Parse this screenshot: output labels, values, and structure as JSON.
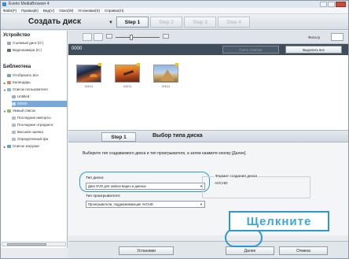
{
  "window": {
    "title": "Everio MediaBrowser 4",
    "controls": [
      "minimize",
      "maximize",
      "close"
    ]
  },
  "menu": [
    "Файл(F)",
    "Правка(E)",
    "Вид(V)",
    "Окно(W)",
    "Установки(S)",
    "Справка(H)"
  ],
  "header": {
    "mode": "Создать диск",
    "mode_arrow": "▼",
    "steps": [
      "Step 1",
      "Step 2",
      "Step 3",
      "Step 4"
    ],
    "active_step": 0
  },
  "sidebar": {
    "device_header": "Устройство",
    "devices": [
      "Съемный диск (G:)",
      "Видеокамера (H:)"
    ],
    "library_header": "Библиотека",
    "library": [
      {
        "label": "Отобразить все",
        "level": 1
      },
      {
        "label": "Календарь",
        "level": 1,
        "caret": "►"
      },
      {
        "label": "Список пользователя",
        "level": 1,
        "caret": "▼"
      },
      {
        "label": "Untitled",
        "level": 2
      },
      {
        "label": "00000",
        "level": 2,
        "selected": true
      },
      {
        "label": "Умный список",
        "level": 1,
        "caret": "▼"
      },
      {
        "label": "Последние импорты",
        "level": 2
      },
      {
        "label": "Последние отредакти",
        "level": 2
      },
      {
        "label": "Высшая оценка",
        "level": 2
      },
      {
        "label": "Определенный фа",
        "level": 2
      },
      {
        "label": "Список загрузки",
        "level": 1,
        "caret": "►"
      }
    ]
  },
  "toolbar": {
    "filter_label": "Фильтр"
  },
  "album": {
    "name": "0000",
    "uncheck_all_label": "Снять отметки",
    "select_all_label": "Выделить все"
  },
  "thumbnails": [
    {
      "label": "3/3/11"
    },
    {
      "label": "3/3/11"
    },
    {
      "label": "3/3/11"
    }
  ],
  "panel": {
    "step_label": "Step 1",
    "title": "Выбор типа диска",
    "instruction": "Выберите тип создаваемого диска и тип проигрывателя, а затем нажмите кнопку [Далее].",
    "disc_type_label": "Тип диска:",
    "disc_type_value": "Диск DVD для записи видео и данных",
    "player_type_label": "Тип проигрывателя:",
    "player_type_value": "Проигрыватели, поддерживающие AVCHD",
    "format_label": "Формат создания диска",
    "format_value": "AVCHD"
  },
  "callout": {
    "text": "Щелкните"
  },
  "bottom": {
    "settings_label": "Установки",
    "next_label": "Далее",
    "cancel_label": "Отмена"
  },
  "colors": {
    "accent": "#2f97d0",
    "callout_text": "#3fa6dc",
    "album_bar": "#3f4c5a",
    "selected_item": "#7aa8d6"
  }
}
